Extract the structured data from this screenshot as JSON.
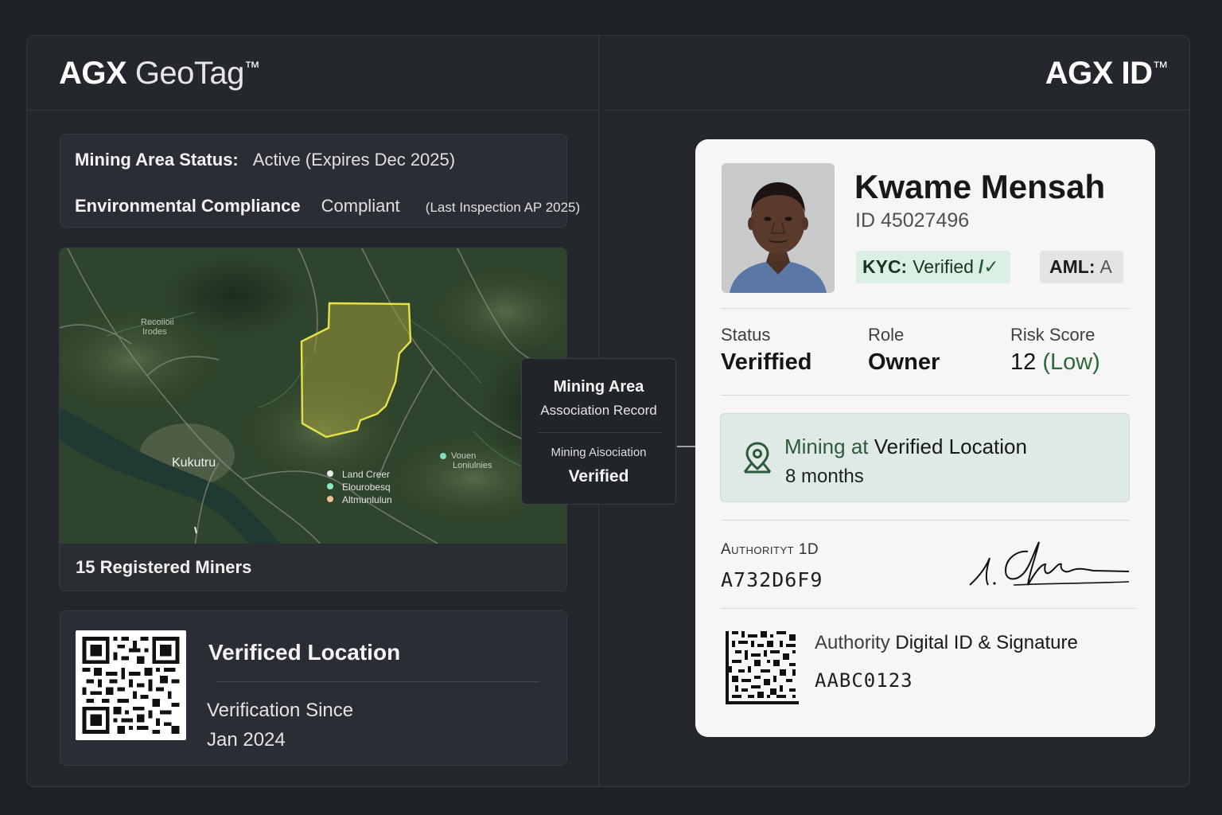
{
  "left_panel": {
    "brand_bold": "AGX",
    "brand_light": "GeoTag",
    "brand_mark": "™",
    "status": {
      "area_status_label": "Mining Area Status:",
      "area_status_value": "Active (Expires Dec 2025)",
      "env_label": "Environmental Compliance",
      "env_value": "Compliant",
      "env_note": "(Last Inspection AP 2025)"
    },
    "map": {
      "labels": {
        "top_left_1": "Recoiioii",
        "top_left_2": "Irodes",
        "town": "Kukutru",
        "legend_1": "Land Creer",
        "legend_2": "Elourobesq",
        "legend_3": "Altmunlulun",
        "right_1": "Vouen",
        "right_2": "Loniulnies"
      },
      "footer": "15 Registered Miners",
      "colors": {
        "polygon": "#e6e34a",
        "legend_1": "#e8ecef",
        "legend_2": "#8de8c4",
        "legend_3": "#f3c092",
        "right_dot": "#7fe0c0"
      }
    },
    "popup": {
      "title": "Mining Area",
      "subtitle": "Association Record",
      "assoc_label": "Mining Aisociation",
      "assoc_value": "Verified"
    },
    "location_card": {
      "title": "Verificed Location",
      "since_label": "Verification Since",
      "since_value": "Jan 2024"
    }
  },
  "right_panel": {
    "brand": "AGX ID",
    "brand_mark": "™",
    "id_card": {
      "name": "Kwame Mensah",
      "id_number": "ID 45027496",
      "kyc_label": "KYC:",
      "kyc_value": "Verified",
      "kyc_check": "/✓",
      "aml_label": "AML:",
      "aml_value": "A",
      "stats": [
        {
          "label": "Status",
          "value": "Veriffied"
        },
        {
          "label": "Role",
          "value": "Owner"
        },
        {
          "label": "Risk Score",
          "value": "12",
          "qualifier": "(Low)"
        }
      ],
      "location_banner": {
        "prefix": "Mining at",
        "emphasis": "Verified Location",
        "duration": "8 months"
      },
      "authority_id_label": "Authorityt 1D",
      "authority_id_value": "A732D6F9",
      "digital_label_prefix": "Authority",
      "digital_label_emphasis": "Digital ID & Signature",
      "digital_value": "AABC0123",
      "colors": {
        "accent_green": "#2c6a3d",
        "kyc_bg": "#dcefe4",
        "banner_bg": "#dfe9e5"
      }
    }
  }
}
